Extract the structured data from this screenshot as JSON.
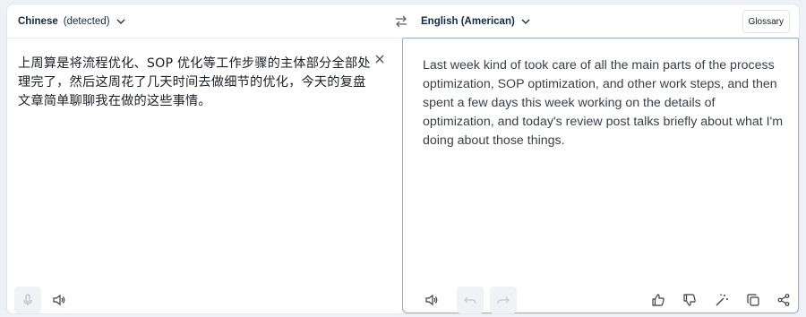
{
  "source": {
    "language": "Chinese",
    "detected_label": "(detected)",
    "text": "上周算是将流程优化、SOP 优化等工作步骤的主体部分全部处理完了，然后这周花了几天时间去做细节的优化，今天的复盘文章简单聊聊我在做的这些事情。"
  },
  "target": {
    "language": "English (American)",
    "text": "Last week kind of took care of all the main parts of the process optimization, SOP optimization, and other work steps, and then spent a few days this week working on the details of optimization, and today's review post talks briefly about what I'm doing about those things."
  },
  "toolbar": {
    "glossary_label": "Glossary"
  },
  "icons": {
    "swap": "swap-arrows-icon",
    "chevron": "chevron-down-icon",
    "clear": "close-icon",
    "mic": "microphone-icon",
    "speaker": "speaker-icon",
    "undo": "undo-icon",
    "redo": "redo-icon",
    "thumbs_up": "thumbs-up-icon",
    "thumbs_down": "thumbs-down-icon",
    "magic": "magic-wand-icon",
    "copy": "copy-icon",
    "share": "share-icon"
  },
  "colors": {
    "accent": "#0f2b46",
    "panel_border": "#8fb1cf",
    "disabled_bg": "#f0f2f5"
  }
}
